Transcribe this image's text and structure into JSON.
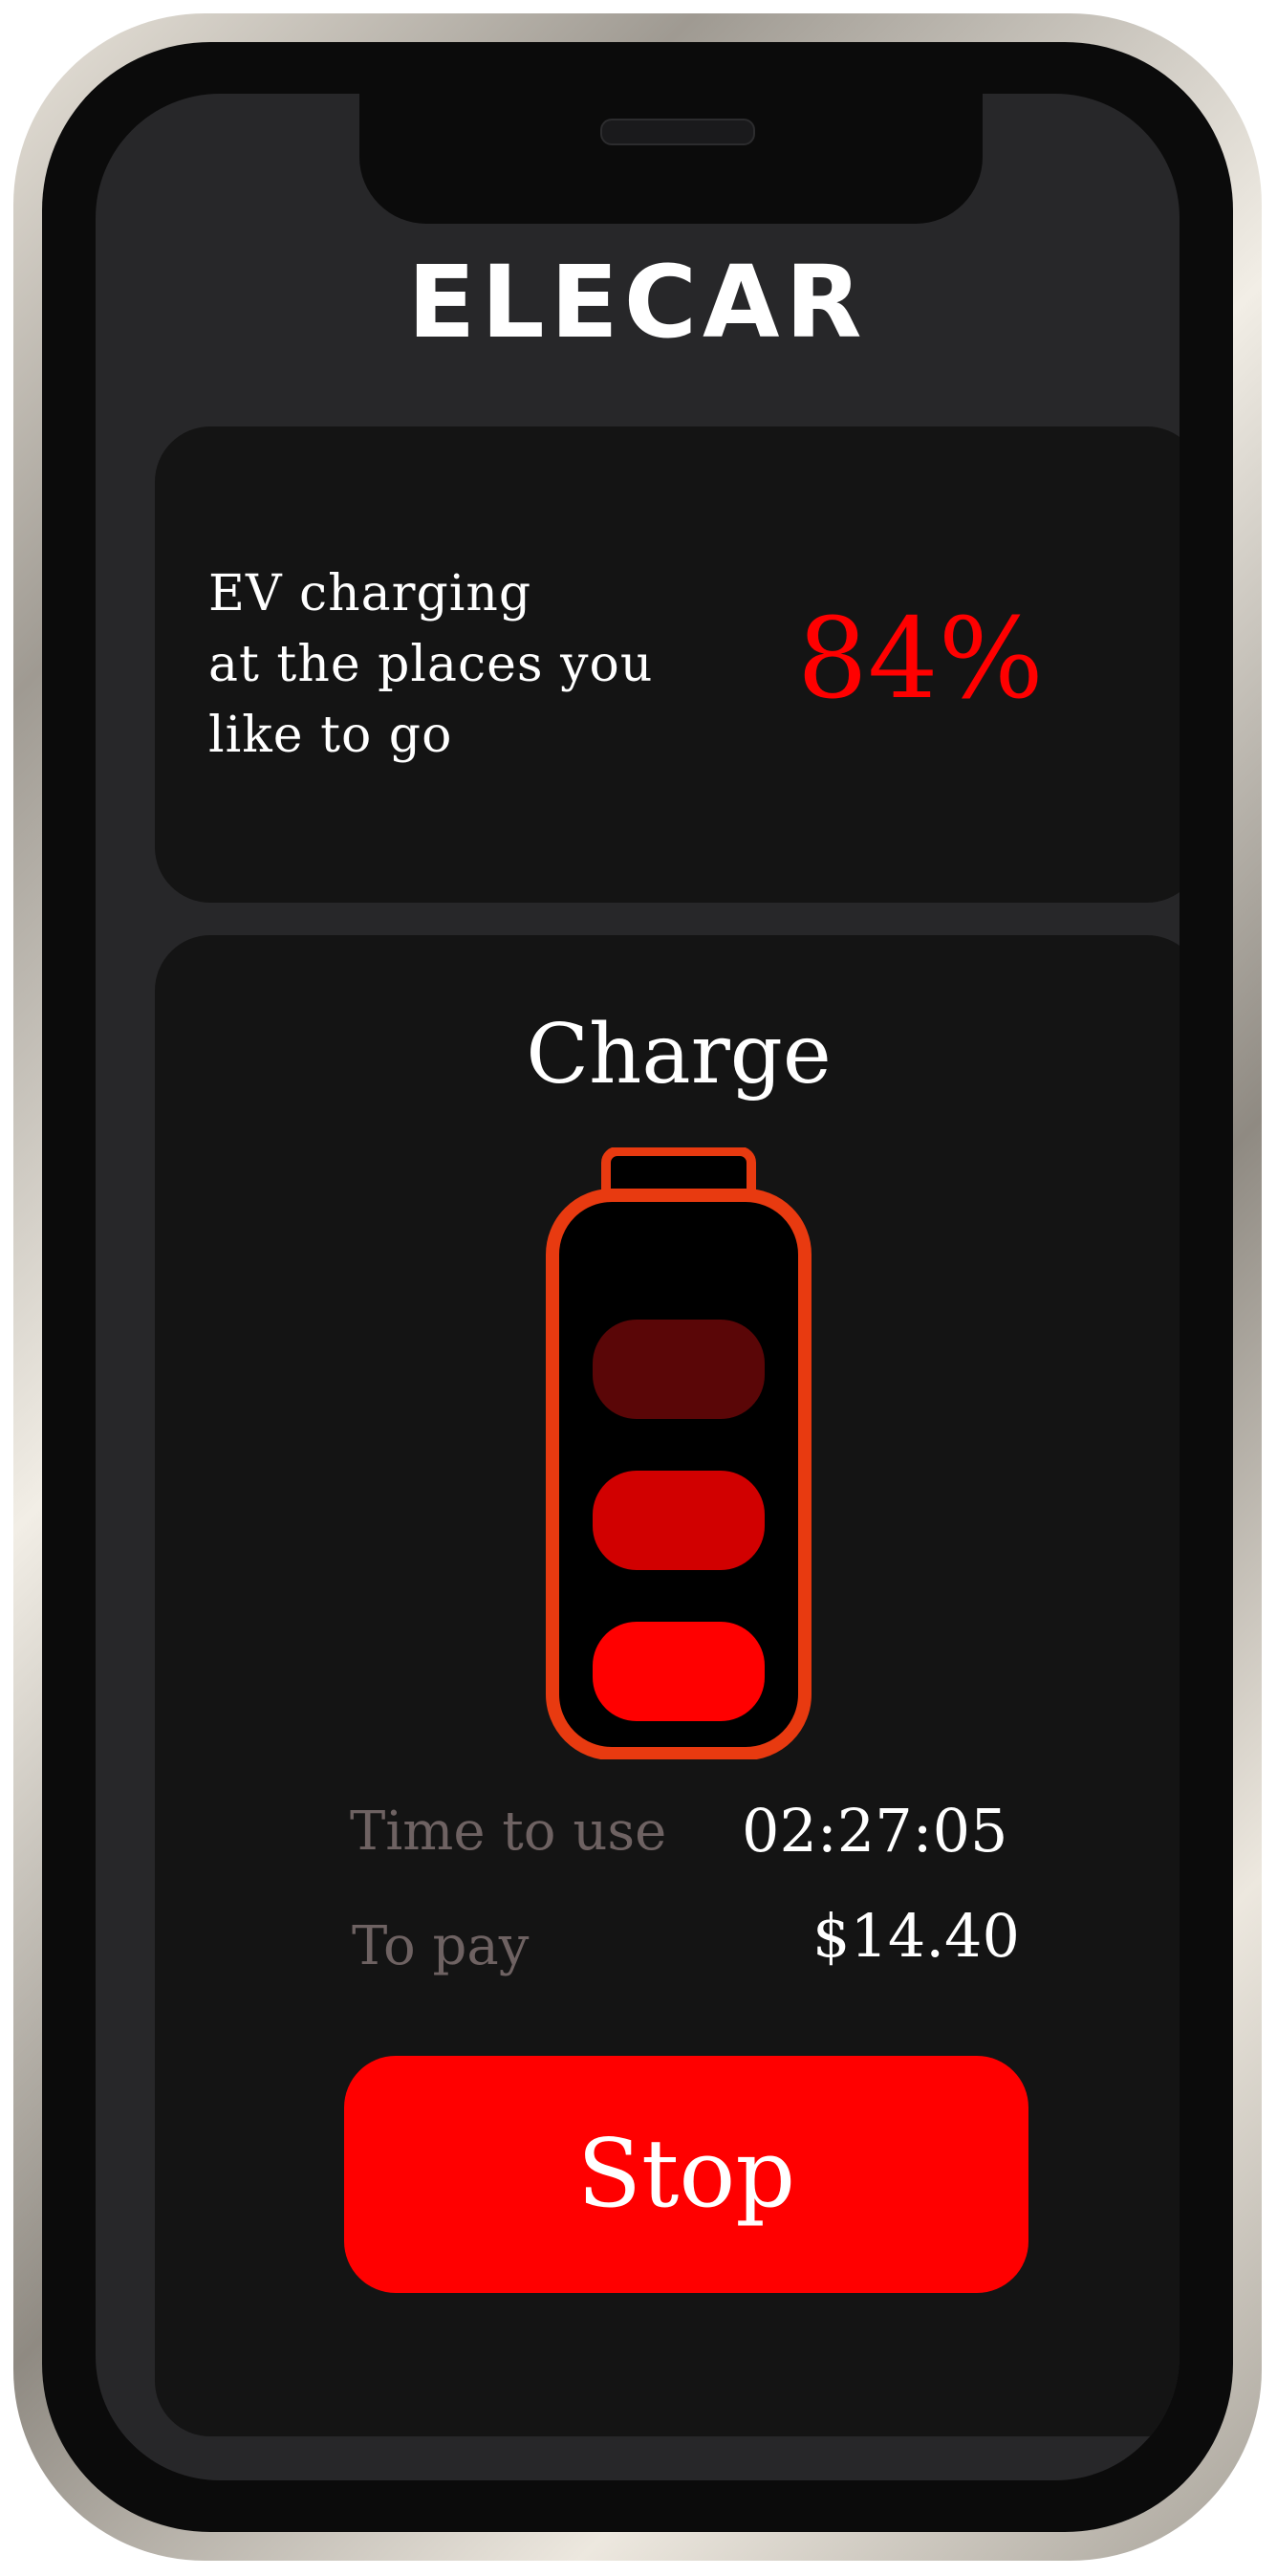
{
  "app": {
    "logo": "ELECAR"
  },
  "promo": {
    "tagline_line1": "EV charging",
    "tagline_line2": "at the places you",
    "tagline_line3": "like to go",
    "percent": "84%"
  },
  "charge": {
    "title": "Charge",
    "battery_level_bars": 3,
    "time_label": "Time to use",
    "time_value": "02:27:05",
    "pay_label": "To pay",
    "pay_value": "$14.40",
    "stop_label": "Stop"
  },
  "colors": {
    "accent": "#ff0000",
    "battery_outline": "#e83a10",
    "bar_top": "#5a0607",
    "bar_mid": "#d10000",
    "bar_bottom": "#ff0000",
    "card_bg": "#141414",
    "screen_bg": "#272729",
    "muted_label": "#6e6262"
  },
  "icons": {
    "battery": "battery-charging-icon"
  }
}
